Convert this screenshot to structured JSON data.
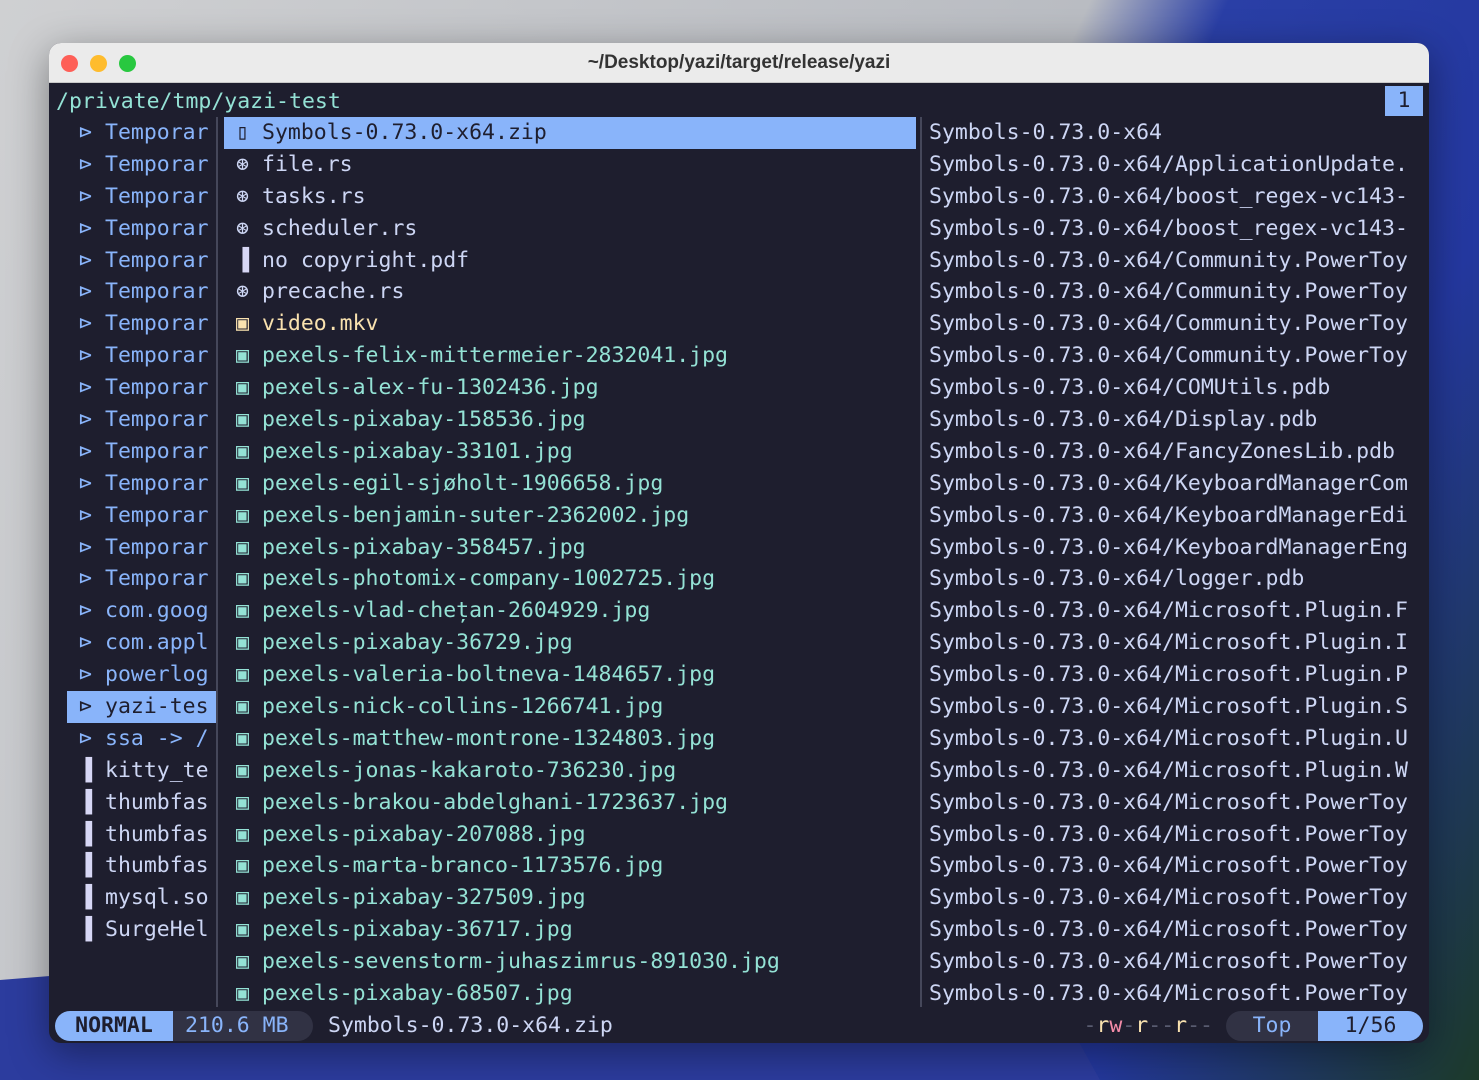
{
  "window": {
    "title": "~/Desktop/yazi/target/release/yazi"
  },
  "header": {
    "path": "/private/tmp/yazi-test",
    "tab": "1"
  },
  "parent": [
    {
      "name": "Temporar",
      "type": "folder"
    },
    {
      "name": "Temporar",
      "type": "folder"
    },
    {
      "name": "Temporar",
      "type": "folder"
    },
    {
      "name": "Temporar",
      "type": "folder"
    },
    {
      "name": "Temporar",
      "type": "folder"
    },
    {
      "name": "Temporar",
      "type": "folder"
    },
    {
      "name": "Temporar",
      "type": "folder"
    },
    {
      "name": "Temporar",
      "type": "folder"
    },
    {
      "name": "Temporar",
      "type": "folder"
    },
    {
      "name": "Temporar",
      "type": "folder"
    },
    {
      "name": "Temporar",
      "type": "folder"
    },
    {
      "name": "Temporar",
      "type": "folder"
    },
    {
      "name": "Temporar",
      "type": "folder"
    },
    {
      "name": "Temporar",
      "type": "folder"
    },
    {
      "name": "Temporar",
      "type": "folder"
    },
    {
      "name": "com.goog",
      "type": "folder"
    },
    {
      "name": "com.appl",
      "type": "folder"
    },
    {
      "name": "powerlog",
      "type": "folder"
    },
    {
      "name": "yazi-tes",
      "type": "folder",
      "selected": true
    },
    {
      "name": "ssa -> /",
      "type": "folder"
    },
    {
      "name": "kitty_te",
      "type": "file"
    },
    {
      "name": "thumbfas",
      "type": "file"
    },
    {
      "name": "thumbfas",
      "type": "file"
    },
    {
      "name": "thumbfas",
      "type": "file"
    },
    {
      "name": "mysql.so",
      "type": "file"
    },
    {
      "name": "SurgeHel",
      "type": "file"
    }
  ],
  "current": [
    {
      "name": "Symbols-0.73.0-x64.zip",
      "type": "zip",
      "selected": true
    },
    {
      "name": "file.rs",
      "type": "rs"
    },
    {
      "name": "tasks.rs",
      "type": "rs"
    },
    {
      "name": "scheduler.rs",
      "type": "rs"
    },
    {
      "name": "no copyright.pdf",
      "type": "file"
    },
    {
      "name": "precache.rs",
      "type": "rs"
    },
    {
      "name": "video.mkv",
      "type": "vid"
    },
    {
      "name": "pexels-felix-mittermeier-2832041.jpg",
      "type": "img"
    },
    {
      "name": "pexels-alex-fu-1302436.jpg",
      "type": "img"
    },
    {
      "name": "pexels-pixabay-158536.jpg",
      "type": "img"
    },
    {
      "name": "pexels-pixabay-33101.jpg",
      "type": "img"
    },
    {
      "name": "pexels-egil-sjøholt-1906658.jpg",
      "type": "img"
    },
    {
      "name": "pexels-benjamin-suter-2362002.jpg",
      "type": "img"
    },
    {
      "name": "pexels-pixabay-358457.jpg",
      "type": "img"
    },
    {
      "name": "pexels-photomix-company-1002725.jpg",
      "type": "img"
    },
    {
      "name": "pexels-vlad-chețan-2604929.jpg",
      "type": "img"
    },
    {
      "name": "pexels-pixabay-36729.jpg",
      "type": "img"
    },
    {
      "name": "pexels-valeria-boltneva-1484657.jpg",
      "type": "img"
    },
    {
      "name": "pexels-nick-collins-1266741.jpg",
      "type": "img"
    },
    {
      "name": "pexels-matthew-montrone-1324803.jpg",
      "type": "img"
    },
    {
      "name": "pexels-jonas-kakaroto-736230.jpg",
      "type": "img"
    },
    {
      "name": "pexels-brakou-abdelghani-1723637.jpg",
      "type": "img"
    },
    {
      "name": "pexels-pixabay-207088.jpg",
      "type": "img"
    },
    {
      "name": "pexels-marta-branco-1173576.jpg",
      "type": "img"
    },
    {
      "name": "pexels-pixabay-327509.jpg",
      "type": "img"
    },
    {
      "name": "pexels-pixabay-36717.jpg",
      "type": "img"
    },
    {
      "name": "pexels-sevenstorm-juhaszimrus-891030.jpg",
      "type": "img"
    },
    {
      "name": "pexels-pixabay-68507.jpg",
      "type": "img"
    }
  ],
  "preview": [
    "Symbols-0.73.0-x64",
    "Symbols-0.73.0-x64/ApplicationUpdate.",
    "Symbols-0.73.0-x64/boost_regex-vc143-",
    "Symbols-0.73.0-x64/boost_regex-vc143-",
    "Symbols-0.73.0-x64/Community.PowerToy",
    "Symbols-0.73.0-x64/Community.PowerToy",
    "Symbols-0.73.0-x64/Community.PowerToy",
    "Symbols-0.73.0-x64/Community.PowerToy",
    "Symbols-0.73.0-x64/COMUtils.pdb",
    "Symbols-0.73.0-x64/Display.pdb",
    "Symbols-0.73.0-x64/FancyZonesLib.pdb",
    "Symbols-0.73.0-x64/KeyboardManagerCom",
    "Symbols-0.73.0-x64/KeyboardManagerEdi",
    "Symbols-0.73.0-x64/KeyboardManagerEng",
    "Symbols-0.73.0-x64/logger.pdb",
    "Symbols-0.73.0-x64/Microsoft.Plugin.F",
    "Symbols-0.73.0-x64/Microsoft.Plugin.I",
    "Symbols-0.73.0-x64/Microsoft.Plugin.P",
    "Symbols-0.73.0-x64/Microsoft.Plugin.S",
    "Symbols-0.73.0-x64/Microsoft.Plugin.U",
    "Symbols-0.73.0-x64/Microsoft.Plugin.W",
    "Symbols-0.73.0-x64/Microsoft.PowerToy",
    "Symbols-0.73.0-x64/Microsoft.PowerToy",
    "Symbols-0.73.0-x64/Microsoft.PowerToy",
    "Symbols-0.73.0-x64/Microsoft.PowerToy",
    "Symbols-0.73.0-x64/Microsoft.PowerToy",
    "Symbols-0.73.0-x64/Microsoft.PowerToy",
    "Symbols-0.73.0-x64/Microsoft.PowerToy"
  ],
  "status": {
    "mode": "NORMAL",
    "size": "210.6 MB",
    "filename": "Symbols-0.73.0-x64.zip",
    "perm": [
      "-",
      "r",
      "w",
      "-",
      "r",
      "-",
      "-",
      "r",
      "-",
      "-"
    ],
    "scroll": "Top",
    "position": "1/56"
  },
  "colors": {
    "accent": "#89b4fa",
    "bg": "#1e1e2e",
    "image": "#94e2d5",
    "video": "#f9e2af"
  }
}
